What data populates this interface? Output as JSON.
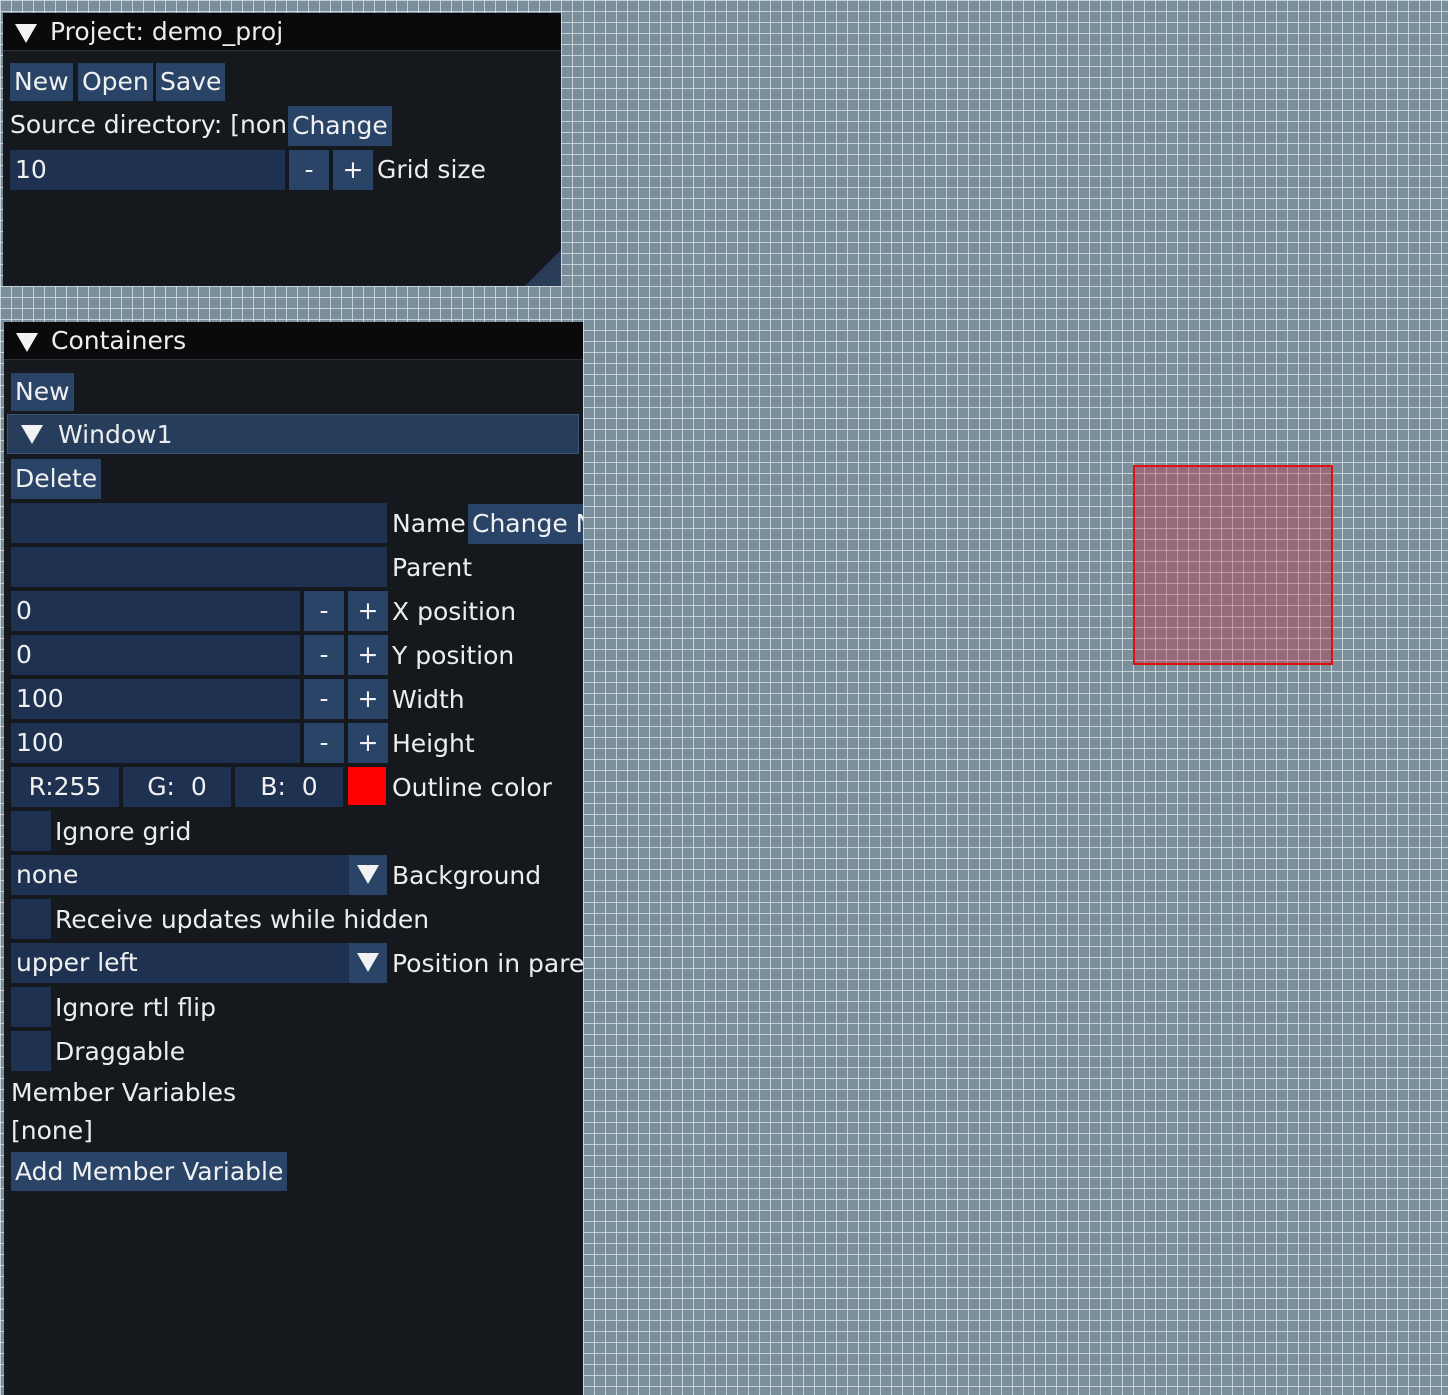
{
  "project_panel": {
    "title_prefix": "Project: ",
    "project_name": "demo_proj",
    "new_label": "New",
    "open_label": "Open",
    "save_label": "Save",
    "source_dir_label": "Source directory: [none]",
    "change_label": "Change",
    "grid_size_value": "10",
    "minus_label": "-",
    "plus_label": "+",
    "grid_size_label": "Grid size"
  },
  "containers_panel": {
    "title": "Containers",
    "new_label": "New",
    "window": {
      "name": "Window1",
      "delete_label": "Delete",
      "name_value": "",
      "name_label": "Name",
      "change_name_label": "Change N",
      "parent_value": "",
      "parent_label": "Parent",
      "minus_label": "-",
      "plus_label": "+",
      "x_value": "0",
      "x_label": "X position",
      "y_value": "0",
      "y_label": "Y position",
      "width_value": "100",
      "width_label": "Width",
      "height_value": "100",
      "height_label": "Height",
      "color_r": "R:255",
      "color_g": "G:  0",
      "color_b": "B:  0",
      "outline_color_label": "Outline color",
      "ignore_grid_label": "Ignore grid",
      "background_value": "none",
      "background_label": "Background",
      "receive_updates_label": "Receive updates while hidden",
      "position_value": "upper left",
      "position_label": "Position in paren",
      "ignore_rtl_label": "Ignore rtl flip",
      "draggable_label": "Draggable",
      "member_variables_label": "Member Variables",
      "member_variables_value": "[none]",
      "add_member_variable_label": "Add Member Variable"
    }
  },
  "colors": {
    "canvas_background": "#7a8e9c",
    "grid_line": "#e8eef2",
    "panel_background": "#15181d",
    "title_bar": "#0a0a0c",
    "button": "#294467",
    "input": "#1f3150",
    "outline_swatch": "#ff0000",
    "preview_outline": "#e01010",
    "preview_fill": "rgba(200,40,60,0.35)"
  }
}
